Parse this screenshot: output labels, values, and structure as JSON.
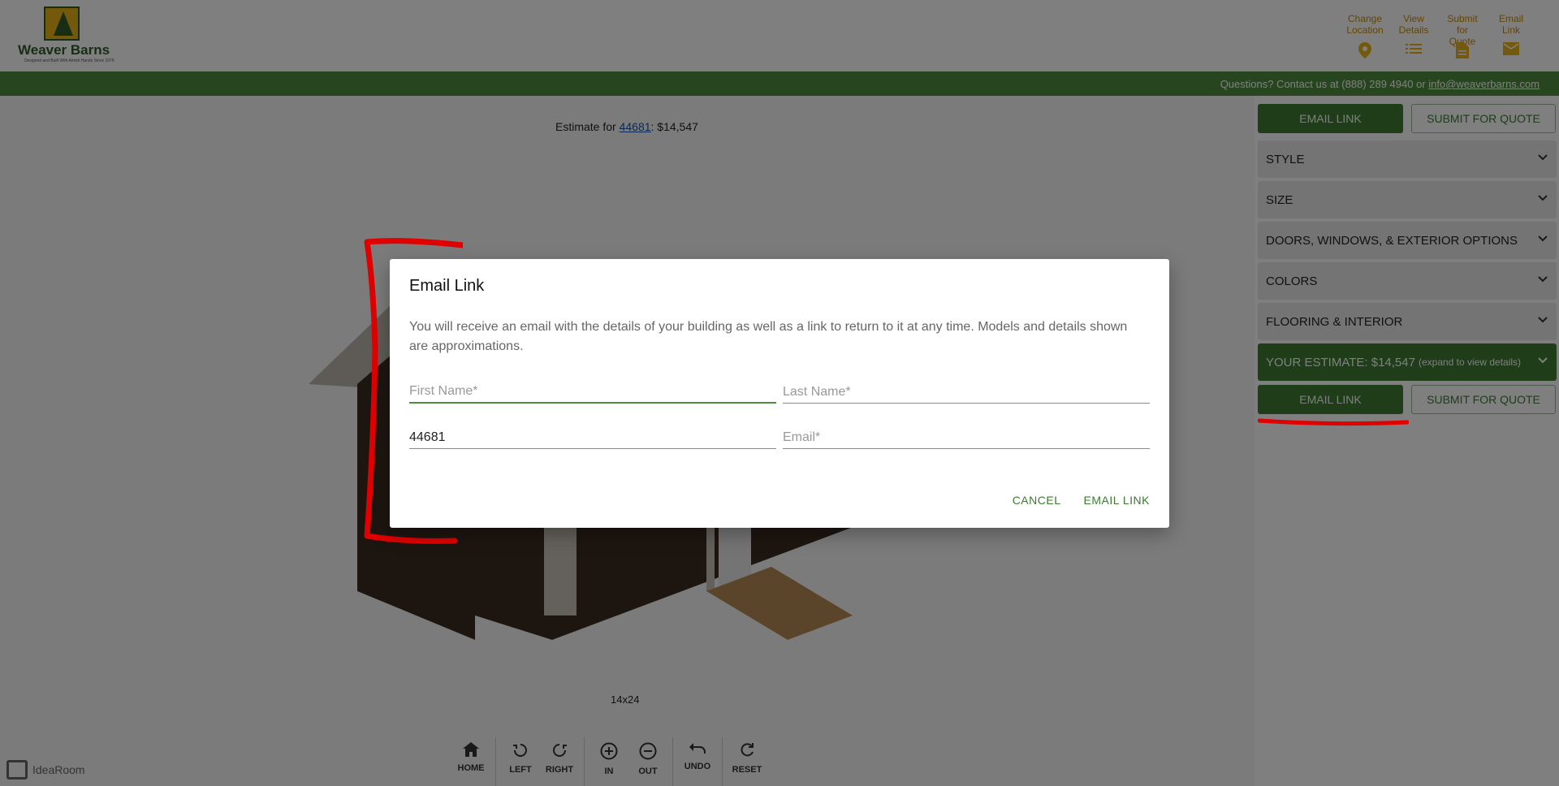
{
  "header": {
    "logo_text": "Weaver Barns",
    "logo_tagline": "Designed and Built With Amish Hands Since 1976",
    "actions": [
      {
        "label": "Change\nLocation",
        "icon": "map-pin-icon"
      },
      {
        "label": "View\nDetails",
        "icon": "list-icon"
      },
      {
        "label": "Submit\nfor Quote",
        "icon": "document-icon"
      },
      {
        "label": "Email\nLink",
        "icon": "envelope-icon"
      }
    ]
  },
  "contact_bar": {
    "text": "Questions? Contact us at (888) 289 4940 or ",
    "email": "info@weaverbarns.com"
  },
  "viewer": {
    "estimate_prefix": "Estimate for ",
    "zip": "44681",
    "estimate_suffix": ": $14,547",
    "size_label": "14x24",
    "controls": {
      "home": "HOME",
      "left": "LEFT",
      "right": "RIGHT",
      "in": "IN",
      "out": "OUT",
      "undo": "UNDO",
      "reset": "RESET"
    },
    "brand": "IdeaRoom"
  },
  "sidebar": {
    "top_email": "EMAIL LINK",
    "top_submit": "SUBMIT FOR QUOTE",
    "panels": {
      "style": "STYLE",
      "size": "SIZE",
      "doors": "DOORS, WINDOWS, & EXTERIOR OPTIONS",
      "colors": "COLORS",
      "flooring": "FLOORING & INTERIOR"
    },
    "estimate_main": "YOUR ESTIMATE: $14,547",
    "estimate_note": "(expand to view details)",
    "bottom_email": "EMAIL LINK",
    "bottom_submit": "SUBMIT FOR QUOTE"
  },
  "dialog": {
    "title": "Email Link",
    "description": "You will receive an email with the details of your building as well as a link to return to it at any time. Models and details shown are approximations.",
    "first_name_placeholder": "First Name*",
    "last_name_placeholder": "Last Name*",
    "zip_value": "44681",
    "email_placeholder": "Email*",
    "cancel": "CANCEL",
    "submit": "EMAIL LINK"
  },
  "colors": {
    "brand_green": "#3d7a31",
    "bar_green": "#4e8b3f",
    "accent_orange": "#c98a00",
    "annotation_red": "#e00000"
  }
}
